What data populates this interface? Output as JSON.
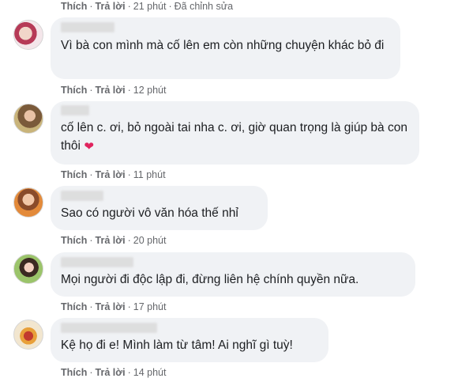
{
  "top_actions": {
    "like": "Thích",
    "reply": "Trả lời",
    "time": "21 phút",
    "edited": "Đã chỉnh sửa"
  },
  "comments": [
    {
      "text": "Vì bà con mình mà cố lên em còn những chuyện khác bỏ đi",
      "like": "Thích",
      "reply": "Trả lời",
      "time": "12 phút"
    },
    {
      "text": "cố lên c. ơi, bỏ ngoài tai nha c. ơi, giờ quan trọng là giúp bà con thôi",
      "emoji": "❤",
      "like": "Thích",
      "reply": "Trả lời",
      "time": "11 phút"
    },
    {
      "text": "Sao có người vô văn hóa thế nhỉ",
      "like": "Thích",
      "reply": "Trả lời",
      "time": "20 phút"
    },
    {
      "text": "Mọi người đi độc lập đi, đừng liên hệ chính quyền nữa.",
      "like": "Thích",
      "reply": "Trả lời",
      "time": "17 phút"
    },
    {
      "text": "Kệ họ đi e! Mình làm từ tâm! Ai nghĩ gì tuỳ!",
      "like": "Thích",
      "reply": "Trả lời",
      "time": "14 phút"
    }
  ],
  "separator": "·",
  "colors": {
    "bubble_bg": "#f0f2f5",
    "meta_text": "#65676b",
    "body_text": "#1c1e21",
    "heart": "#e0245e"
  }
}
